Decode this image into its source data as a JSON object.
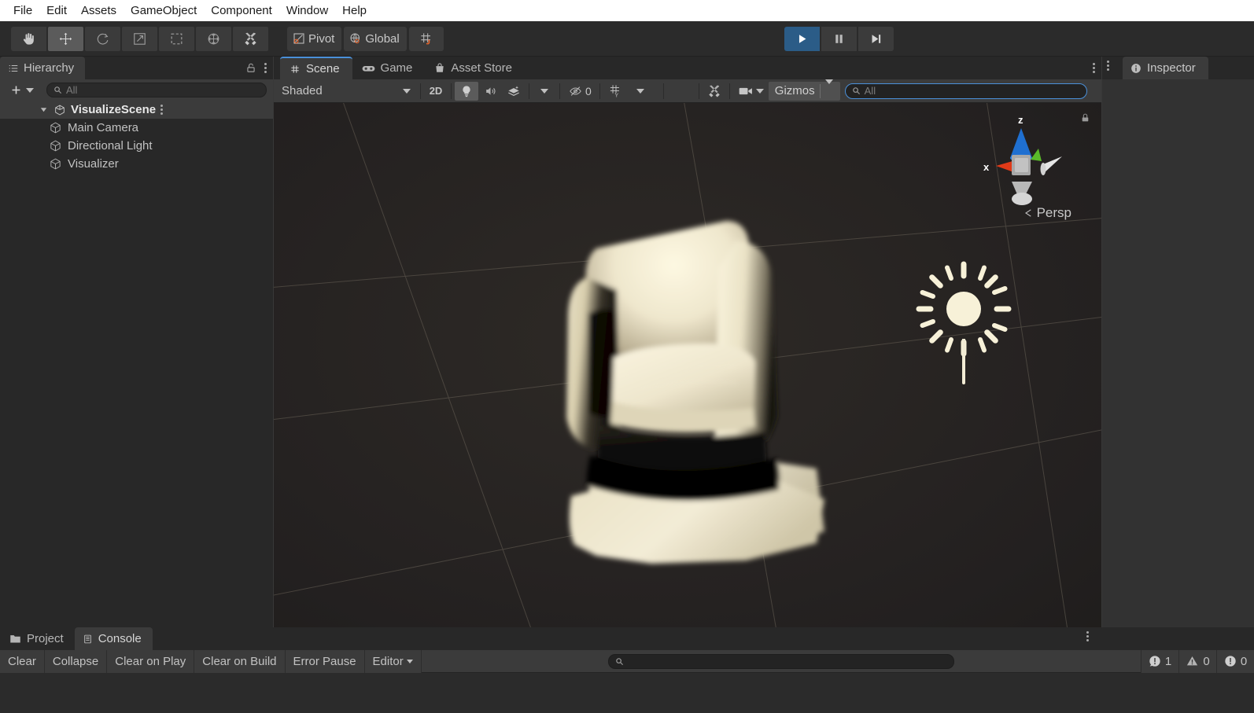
{
  "menubar": {
    "items": [
      {
        "label": "File"
      },
      {
        "label": "Edit"
      },
      {
        "label": "Assets"
      },
      {
        "label": "GameObject"
      },
      {
        "label": "Component"
      },
      {
        "label": "Window"
      },
      {
        "label": "Help"
      }
    ]
  },
  "toolbar": {
    "tools": [
      {
        "name": "hand-tool",
        "active": false
      },
      {
        "name": "move-tool",
        "active": true
      },
      {
        "name": "rotate-tool",
        "active": false
      },
      {
        "name": "scale-tool",
        "active": false
      },
      {
        "name": "rect-tool",
        "active": false
      },
      {
        "name": "transform-tool",
        "active": false
      },
      {
        "name": "custom-editor-tool",
        "active": false
      }
    ],
    "pivot_label": "Pivot",
    "global_label": "Global",
    "grid_snap_name": "grid-snapping-toggle",
    "play_label": "Play",
    "pause_label": "Pause",
    "step_label": "Step",
    "play_active": true,
    "accent_orange": "#e8642a",
    "accent_blue": "#2b5c87"
  },
  "hierarchy": {
    "tab_label": "Hierarchy",
    "lock_name": "lock-icon",
    "add_label": "+",
    "search_placeholder": "All",
    "search_value": "",
    "scene_name": "VisualizeScene",
    "objects": [
      {
        "label": "Main Camera"
      },
      {
        "label": "Directional Light"
      },
      {
        "label": "Visualizer"
      }
    ]
  },
  "scene": {
    "tabs": [
      {
        "label": "Scene",
        "icon": "grid-icon",
        "active": true
      },
      {
        "label": "Game",
        "icon": "gamepad-icon",
        "active": false
      },
      {
        "label": "Asset Store",
        "icon": "shopping-bag-icon",
        "active": false
      }
    ],
    "draw_mode": "Shaded",
    "mode_2d_label": "2D",
    "lighting_on": true,
    "audio_on": false,
    "hidden_count": "0",
    "grid_axis": "Y",
    "gizmos_label": "Gizmos",
    "search_placeholder": "All",
    "search_value": "",
    "view_gizmo": {
      "axis_x": "x",
      "axis_z": "z",
      "projection": "Persp",
      "x_color": "#e03a18",
      "y_color": "#5aba2a",
      "z_color": "#1f6fd0",
      "neutral_color": "#d2d2d2"
    },
    "light_gizmo_name": "directional-light-gizmo",
    "mesh_name": "armchair-mesh",
    "background_color": "#262320",
    "grid_line_color": "#6b6459"
  },
  "inspector": {
    "tab_label": "Inspector",
    "empty": true
  },
  "bottom": {
    "tabs": [
      {
        "label": "Project",
        "icon": "folder-icon",
        "active": false
      },
      {
        "label": "Console",
        "icon": "console-icon",
        "active": true
      }
    ],
    "console_buttons": [
      {
        "label": "Clear",
        "has_caret": false
      },
      {
        "label": "Collapse",
        "has_caret": false
      },
      {
        "label": "Clear on Play",
        "has_caret": false
      },
      {
        "label": "Clear on Build",
        "has_caret": false
      },
      {
        "label": "Error Pause",
        "has_caret": false
      },
      {
        "label": "Editor",
        "has_caret": true
      }
    ],
    "search_placeholder": "",
    "search_value": "",
    "counters": [
      {
        "name": "error-counter",
        "icon": "error-icon",
        "count": "1"
      },
      {
        "name": "warning-counter",
        "icon": "warning-icon",
        "count": "0"
      },
      {
        "name": "info-counter",
        "icon": "info-icon",
        "count": "0"
      }
    ]
  }
}
